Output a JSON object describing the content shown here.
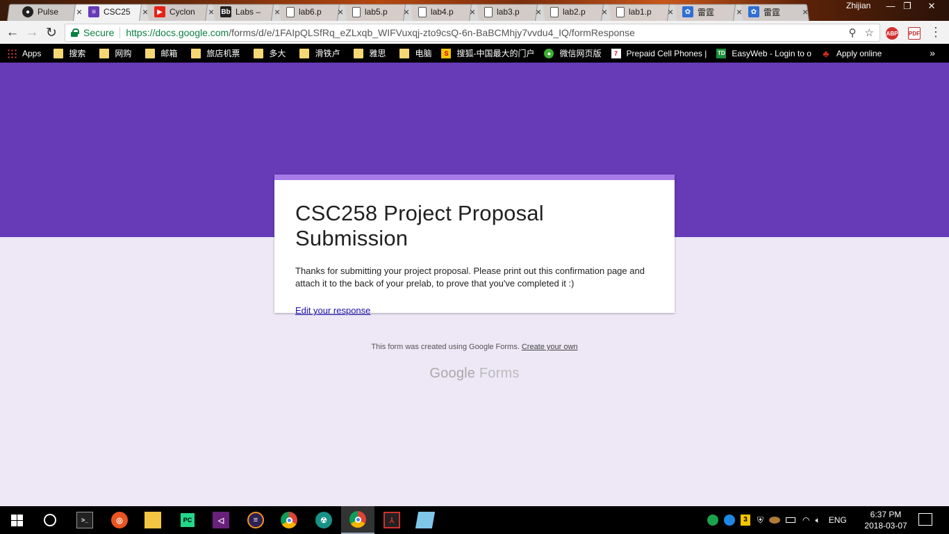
{
  "browser": {
    "tabs": [
      {
        "title": "Pulse",
        "icon": "github-icon",
        "active": false
      },
      {
        "title": "CSC25",
        "icon": "google-forms-icon",
        "active": true
      },
      {
        "title": "Cyclon",
        "icon": "youtube-icon",
        "active": false
      },
      {
        "title": "Labs –",
        "icon": "blackboard-icon",
        "active": false
      },
      {
        "title": "lab6.p",
        "icon": "document-icon",
        "active": false
      },
      {
        "title": "lab5.p",
        "icon": "document-icon",
        "active": false
      },
      {
        "title": "lab4.p",
        "icon": "document-icon",
        "active": false
      },
      {
        "title": "lab3.p",
        "icon": "document-icon",
        "active": false
      },
      {
        "title": "lab2.p",
        "icon": "document-icon",
        "active": false
      },
      {
        "title": "lab1.p",
        "icon": "document-icon",
        "active": false
      },
      {
        "title": "雷霆",
        "icon": "baidu-icon",
        "active": false
      },
      {
        "title": "雷霆",
        "icon": "baidu-icon",
        "active": false
      }
    ],
    "profile_name": "Zhijian",
    "secure_label": "Secure",
    "url_host": "https://docs.google.com",
    "url_path": "/forms/d/e/1FAIpQLSfRq_eZLxqb_WIFVuxqj-zto9csQ-6n-BaBCMhjy7vvdu4_IQ/formResponse",
    "extensions": {
      "adblock": "ABP",
      "pdf": "PDF"
    },
    "bookmarks": [
      {
        "label": "Apps",
        "icon": "apps-grid-icon"
      },
      {
        "label": "搜索",
        "icon": "folder-icon"
      },
      {
        "label": "网购",
        "icon": "folder-icon"
      },
      {
        "label": "邮箱",
        "icon": "folder-icon"
      },
      {
        "label": "旅店机票",
        "icon": "folder-icon"
      },
      {
        "label": "多大",
        "icon": "folder-icon"
      },
      {
        "label": "滑铁卢",
        "icon": "folder-icon"
      },
      {
        "label": "雅思",
        "icon": "folder-icon"
      },
      {
        "label": "电脑",
        "icon": "folder-icon"
      },
      {
        "label": "搜狐-中国最大的门户",
        "icon": "sohu-icon"
      },
      {
        "label": "微信网页版",
        "icon": "wechat-icon"
      },
      {
        "label": "Prepaid Cell Phones |",
        "icon": "seven-eleven-icon"
      },
      {
        "label": "EasyWeb - Login to o",
        "icon": "td-icon"
      },
      {
        "label": "Apply online",
        "icon": "maple-leaf-icon"
      }
    ]
  },
  "form": {
    "title": "CSC258 Project Proposal Submission",
    "message": "Thanks for submitting your project proposal. Please print out this confirmation page and attach it to the back of your prelab, to prove that you've completed it :)",
    "edit_link": "Edit your response",
    "footer_text": "This form was created using Google Forms.",
    "footer_link": "Create your own",
    "brand_google": "Google",
    "brand_forms": "Forms"
  },
  "colors": {
    "banner": "#673ab7",
    "page_bg": "#ede7f6",
    "card_accent": "#a67be8",
    "link": "#1a0dab"
  },
  "taskbar": {
    "apps": [
      "windows-start-icon",
      "cortana-icon",
      "terminal-icon",
      "ubuntu-icon",
      "file-explorer-icon",
      "pycharm-icon",
      "visual-studio-icon",
      "eclipse-icon",
      "chrome-icon",
      "gitkraken-icon",
      "chrome-canary-icon",
      "acrobat-icon",
      "notepad-icon"
    ],
    "tray_badge": "3",
    "language": "ENG",
    "time": "6:37 PM",
    "date": "2018-03-07"
  }
}
